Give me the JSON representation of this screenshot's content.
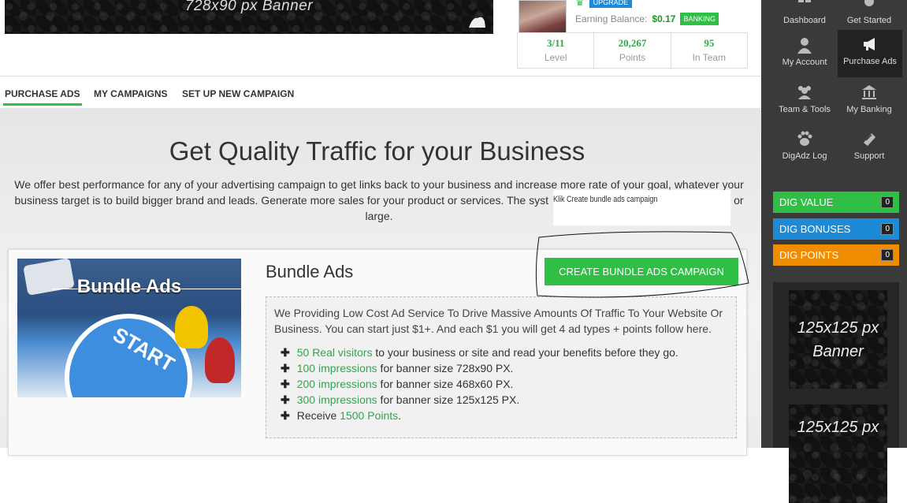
{
  "top_banner": {
    "text": "728x90 px  Banner"
  },
  "profile": {
    "upgrade_label": "UPGRADE",
    "balance_label": "Earning Balance:",
    "balance_value": "$0.17",
    "banking_label": "BANKING",
    "stats": [
      {
        "value": "3/11",
        "label": "Level"
      },
      {
        "value": "20,267",
        "label": "Points"
      },
      {
        "value": "95",
        "label": "In Team"
      }
    ]
  },
  "tabs": [
    "PURCHASE ADS",
    "MY CAMPAIGNS",
    "SET UP NEW CAMPAIGN"
  ],
  "main": {
    "title": "Get Quality Traffic for your Business",
    "intro_before": "We offer best performance for any of your advertising campaign to get links back to your business and increase more rate of your goal, whatever your business target is to build bigger brand and leads. Generate more sales for your product or services. The syst",
    "intro_after": "ll or large.",
    "tooltip": "Klik Create bundle ads campaign"
  },
  "bundle": {
    "image_word": "Bundle Ads",
    "image_start": "START",
    "title": "Bundle Ads",
    "button": "CREATE BUNDLE ADS CAMPAIGN",
    "description": "We Providing Low Cost Ad Service To Drive Massive Amounts Of Traffic To Your Website Or Business. You can start just $1+. And each $1 you will get 4 ad types + points follow here.",
    "features": [
      {
        "highlight": "50 Real visitors",
        "rest": " to your business or site and read your benefits before they go."
      },
      {
        "highlight": "100 impressions",
        "rest": " for banner size 728x90 PX."
      },
      {
        "highlight": "200 impressions",
        "rest": " for banner size 468x60 PX."
      },
      {
        "highlight": "300 impressions",
        "rest": " for banner size 125x125 PX."
      },
      {
        "prefix": "Receive ",
        "highlight": "1500 Points",
        "rest": "."
      }
    ]
  },
  "sidebar": {
    "nav": [
      {
        "label": "Dashboard",
        "icon": "dashboard-icon"
      },
      {
        "label": "Get Started",
        "icon": "get-started-icon"
      },
      {
        "label": "My Account",
        "icon": "user-icon"
      },
      {
        "label": "Purchase Ads",
        "icon": "megaphone-icon"
      },
      {
        "label": "Team & Tools",
        "icon": "team-icon"
      },
      {
        "label": "My Banking",
        "icon": "bank-icon"
      },
      {
        "label": "DigAdz Log",
        "icon": "paw-icon"
      },
      {
        "label": "Support",
        "icon": "support-icon"
      }
    ],
    "meters": [
      {
        "label": "DIG VALUE",
        "count": "0",
        "color": "#2fbf45"
      },
      {
        "label": "DIG BONUSES",
        "count": "0",
        "color": "#1e8ad6"
      },
      {
        "label": "DIG POINTS",
        "count": "0",
        "color": "#f08c00"
      }
    ],
    "banners": [
      "125x125 px Banner",
      "125x125 px"
    ]
  },
  "colors": {
    "accent_green": "#2fbf45",
    "sidebar_bg": "#3a3a3a"
  }
}
